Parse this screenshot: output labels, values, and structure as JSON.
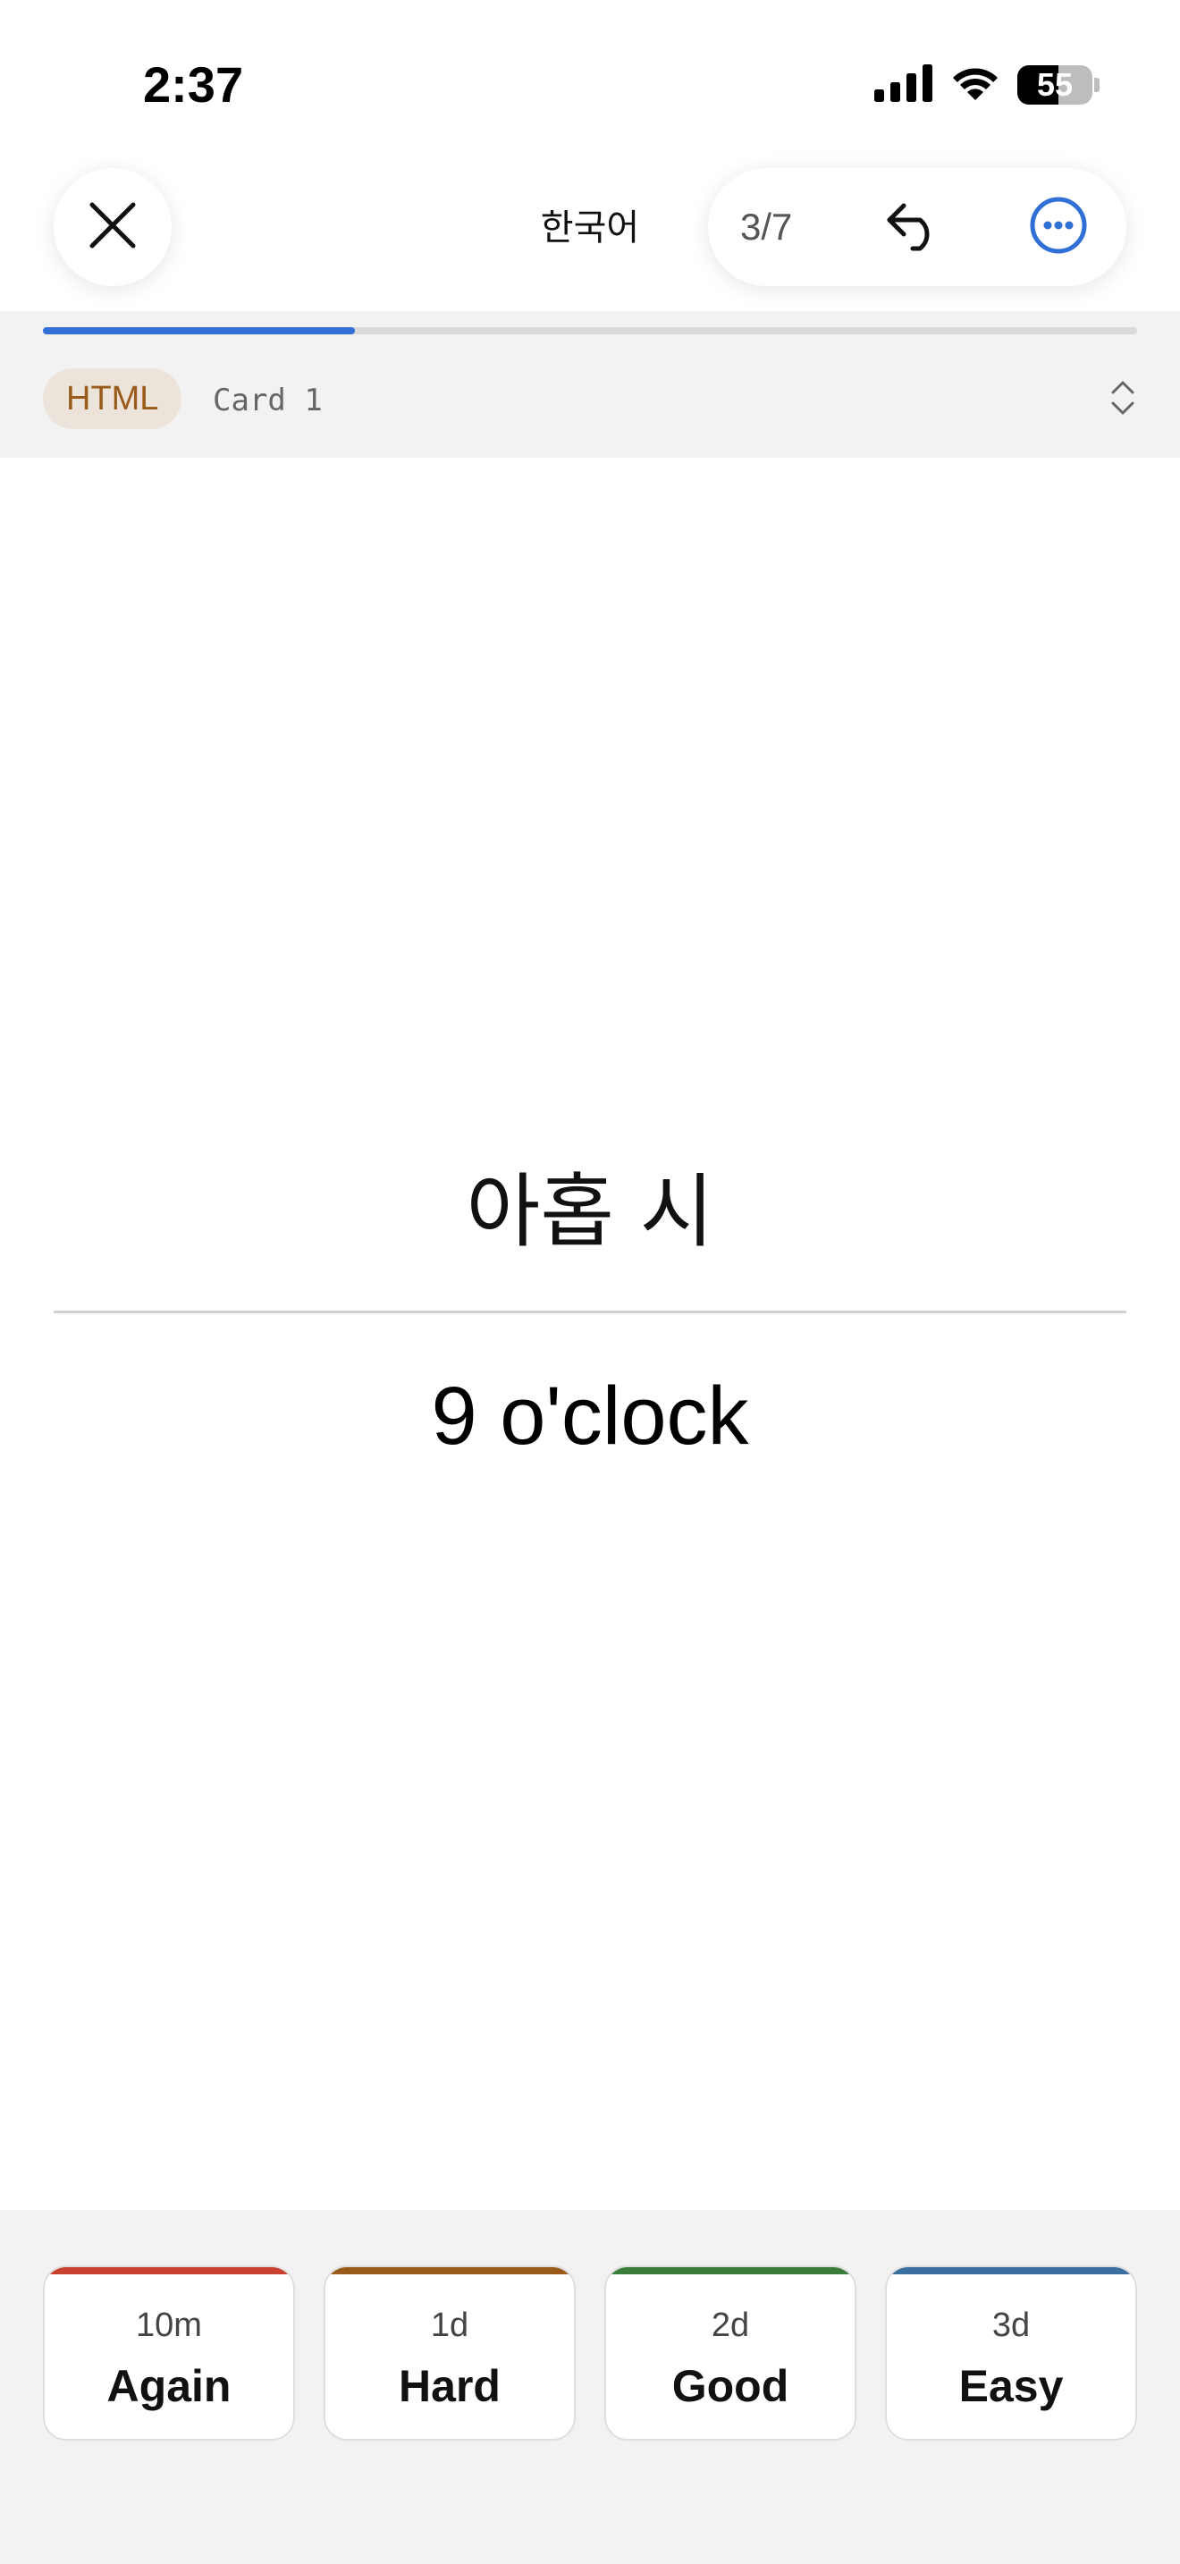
{
  "status_bar": {
    "time": "2:37",
    "battery_level": 55,
    "battery_text": "55"
  },
  "header": {
    "title": "한국어",
    "counter": "3/7",
    "close_icon": "close-icon",
    "undo_icon": "undo-icon",
    "more_icon": "more-icon",
    "accent_color": "#2f6fd6"
  },
  "progress": {
    "fraction": 0.285
  },
  "meta": {
    "tag": "HTML",
    "card_name": "Card 1"
  },
  "card": {
    "front": "아홉 시",
    "back": "9 o'clock"
  },
  "answers": [
    {
      "interval": "10m",
      "label": "Again",
      "color": "#c8402e"
    },
    {
      "interval": "1d",
      "label": "Hard",
      "color": "#9a5b1a"
    },
    {
      "interval": "2d",
      "label": "Good",
      "color": "#3a7d3a"
    },
    {
      "interval": "3d",
      "label": "Easy",
      "color": "#3a6fa0"
    }
  ]
}
